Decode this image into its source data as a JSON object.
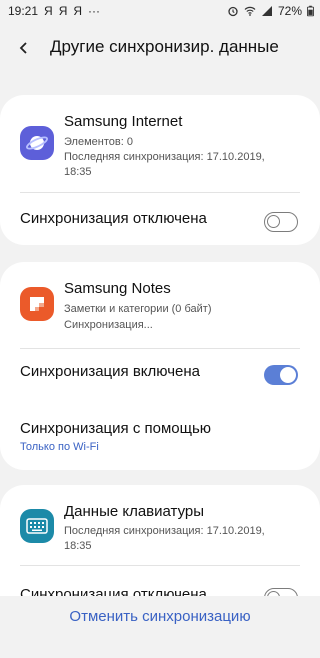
{
  "status": {
    "time": "19:21",
    "notif_glyphs": [
      "Я",
      "Я",
      "Я"
    ],
    "more": "···",
    "battery": "72%"
  },
  "header": {
    "title": "Другие синхронизир. данные"
  },
  "cards": [
    {
      "app_name": "Samsung Internet",
      "sub1": "Элементов: 0",
      "sub2": "Последняя синхронизация: 17.10.2019,",
      "sub3": "18:35",
      "switch_label": "Синхронизация отключена",
      "switch_on": false
    },
    {
      "app_name": "Samsung Notes",
      "sub1": "Заметки и категории (0 байт)",
      "sub2": "Синхронизация...",
      "switch_label": "Синхронизация включена",
      "switch_on": true,
      "sync_with_label": "Синхронизация с помощью",
      "sync_with_value": "Только по Wi-Fi"
    },
    {
      "app_name": "Данные клавиатуры",
      "sub1": "Последняя синхронизация: 17.10.2019,",
      "sub2": "18:35",
      "switch_label": "Синхронизация отключена",
      "switch_on": false
    }
  ],
  "footer": {
    "cancel_label": "Отменить синхронизацию"
  },
  "colors": {
    "accent": "#3a62c4",
    "toggle_on": "#5b7fd6",
    "internet_icon": "#5d5fd9",
    "notes_icon": "#eb5a2a",
    "keyboard_icon": "#1c8aa8"
  },
  "icons": {
    "internet": "samsung-internet-planet-icon",
    "notes": "samsung-notes-icon",
    "keyboard": "keyboard-icon",
    "back": "back-arrow-icon"
  }
}
